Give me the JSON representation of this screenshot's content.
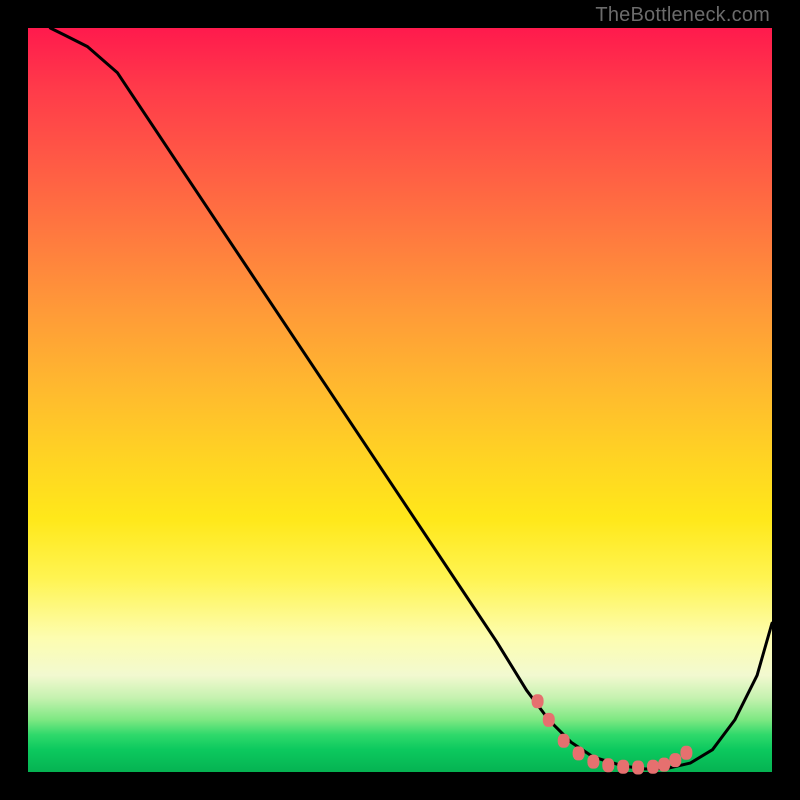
{
  "watermark": "TheBottleneck.com",
  "chart_data": {
    "type": "line",
    "title": "",
    "xlabel": "",
    "ylabel": "",
    "xlim": [
      0,
      100
    ],
    "ylim": [
      0,
      100
    ],
    "series": [
      {
        "name": "bottleneck-curve",
        "x": [
          3,
          5,
          8,
          12,
          20,
          30,
          40,
          50,
          58,
          63,
          67,
          70,
          73,
          76,
          80,
          83,
          86,
          89,
          92,
          95,
          98,
          100
        ],
        "y": [
          100,
          99,
          97.5,
          94,
          82,
          67,
          52,
          37,
          25,
          17.5,
          11,
          7,
          4,
          2,
          0.8,
          0.4,
          0.5,
          1.2,
          3,
          7,
          13,
          20
        ]
      }
    ],
    "markers": {
      "name": "bottleneck-sweet-spot",
      "x": [
        68.5,
        70,
        72,
        74,
        76,
        78,
        80,
        82,
        84,
        85.5,
        87,
        88.5
      ],
      "y": [
        9.5,
        7,
        4.2,
        2.5,
        1.4,
        0.9,
        0.7,
        0.6,
        0.7,
        1.0,
        1.6,
        2.6
      ]
    },
    "grid": false,
    "legend": false
  }
}
